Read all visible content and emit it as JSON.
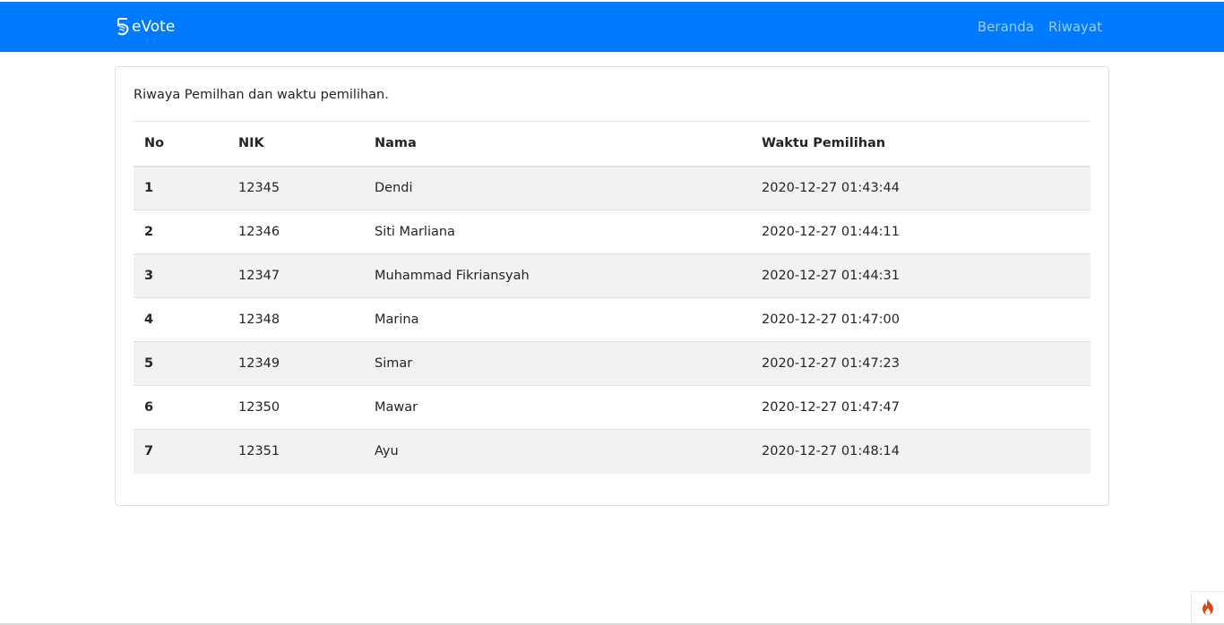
{
  "navbar": {
    "brand_icon": "five-logo-icon",
    "brand_text": "eVote",
    "links": [
      {
        "label": "Beranda"
      },
      {
        "label": "Riwayat"
      }
    ],
    "color": "#007bff"
  },
  "card": {
    "description": "Riwaya Pemilhan dan waktu pemilihan."
  },
  "table": {
    "headers": [
      "No",
      "NIK",
      "Nama",
      "Waktu Pemilihan"
    ],
    "rows": [
      {
        "no": "1",
        "nik": "12345",
        "nama": "Dendi",
        "waktu": "2020-12-27 01:43:44"
      },
      {
        "no": "2",
        "nik": "12346",
        "nama": "Siti Marliana",
        "waktu": "2020-12-27 01:44:11"
      },
      {
        "no": "3",
        "nik": "12347",
        "nama": "Muhammad Fikriansyah",
        "waktu": "2020-12-27 01:44:31"
      },
      {
        "no": "4",
        "nik": "12348",
        "nama": "Marina",
        "waktu": "2020-12-27 01:47:00"
      },
      {
        "no": "5",
        "nik": "12349",
        "nama": "Simar",
        "waktu": "2020-12-27 01:47:23"
      },
      {
        "no": "6",
        "nik": "12350",
        "nama": "Mawar",
        "waktu": "2020-12-27 01:47:47"
      },
      {
        "no": "7",
        "nik": "12351",
        "nama": "Ayu",
        "waktu": "2020-12-27 01:48:14"
      }
    ]
  },
  "toolbar_icon": "flame-icon"
}
